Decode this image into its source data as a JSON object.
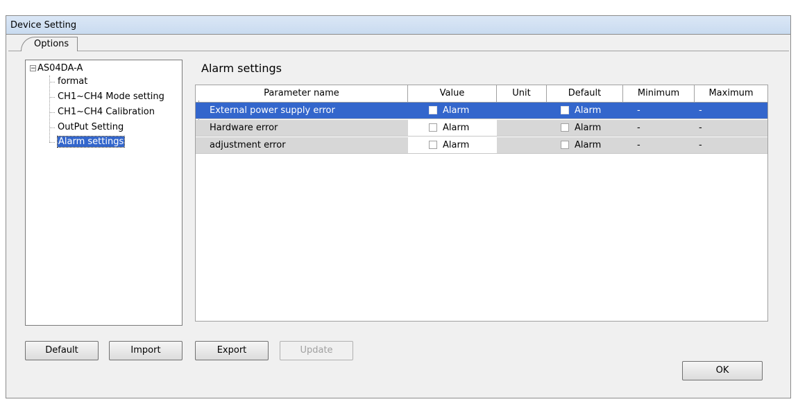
{
  "window": {
    "title": "Device Setting"
  },
  "tabs": [
    {
      "label": "Options"
    }
  ],
  "tree": {
    "root": {
      "label": "AS04DA-A",
      "expander": "⊟"
    },
    "items": [
      {
        "label": "format"
      },
      {
        "label": "CH1~CH4 Mode setting"
      },
      {
        "label": "CH1~CH4 Calibration"
      },
      {
        "label": "OutPut Setting"
      },
      {
        "label": "Alarm settings",
        "selected": true
      }
    ]
  },
  "section": {
    "title": "Alarm settings"
  },
  "grid": {
    "columns": [
      "Parameter name",
      "Value",
      "Unit",
      "Default",
      "Minimum",
      "Maximum"
    ],
    "rows": [
      {
        "name": "External power supply error",
        "value": "Alarm",
        "unit": "",
        "default": "Alarm",
        "minimum": "-",
        "maximum": "-",
        "selected": true
      },
      {
        "name": "Hardware error",
        "value": "Alarm",
        "unit": "",
        "default": "Alarm",
        "minimum": "-",
        "maximum": "-"
      },
      {
        "name": "adjustment error",
        "value": "Alarm",
        "unit": "",
        "default": "Alarm",
        "minimum": "-",
        "maximum": "-"
      }
    ]
  },
  "buttons": {
    "default": "Default",
    "import": "Import",
    "export": "Export",
    "update": "Update",
    "ok": "OK"
  },
  "colors": {
    "selection": "#3366cc",
    "row_gray": "#d7d7d7"
  }
}
